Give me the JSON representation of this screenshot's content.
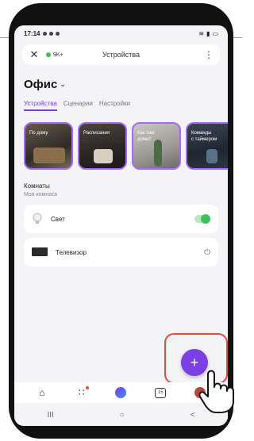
{
  "status": {
    "time": "17:14"
  },
  "appbar": {
    "close": "✕",
    "badge": "9K+",
    "title": "Устройства",
    "menu": "⋮"
  },
  "home": {
    "title": "Офис",
    "chevron": "⌄"
  },
  "tabs": [
    {
      "label": "Устройства",
      "active": true
    },
    {
      "label": "Сценарии",
      "active": false
    },
    {
      "label": "Настройки",
      "active": false
    }
  ],
  "scenario_cards": [
    {
      "label": "По дому"
    },
    {
      "label": "Расписания"
    },
    {
      "label": "Как там\nдома?"
    },
    {
      "label": "Команды\nс таймером"
    }
  ],
  "rooms": {
    "title": "Комнаты",
    "subtitle": "Моя комната"
  },
  "devices": [
    {
      "name": "Свет",
      "state": "on"
    },
    {
      "name": "Телевизор",
      "state": "off"
    }
  ],
  "fab": {
    "label": "+"
  },
  "bottom_nav": {
    "calendar_day": "15"
  },
  "system_nav": {
    "recents": "III",
    "home": "○",
    "back": "<"
  },
  "colors": {
    "accent": "#7b3fe4",
    "toggle_on": "#3ec25a",
    "highlight": "#e8483e"
  }
}
